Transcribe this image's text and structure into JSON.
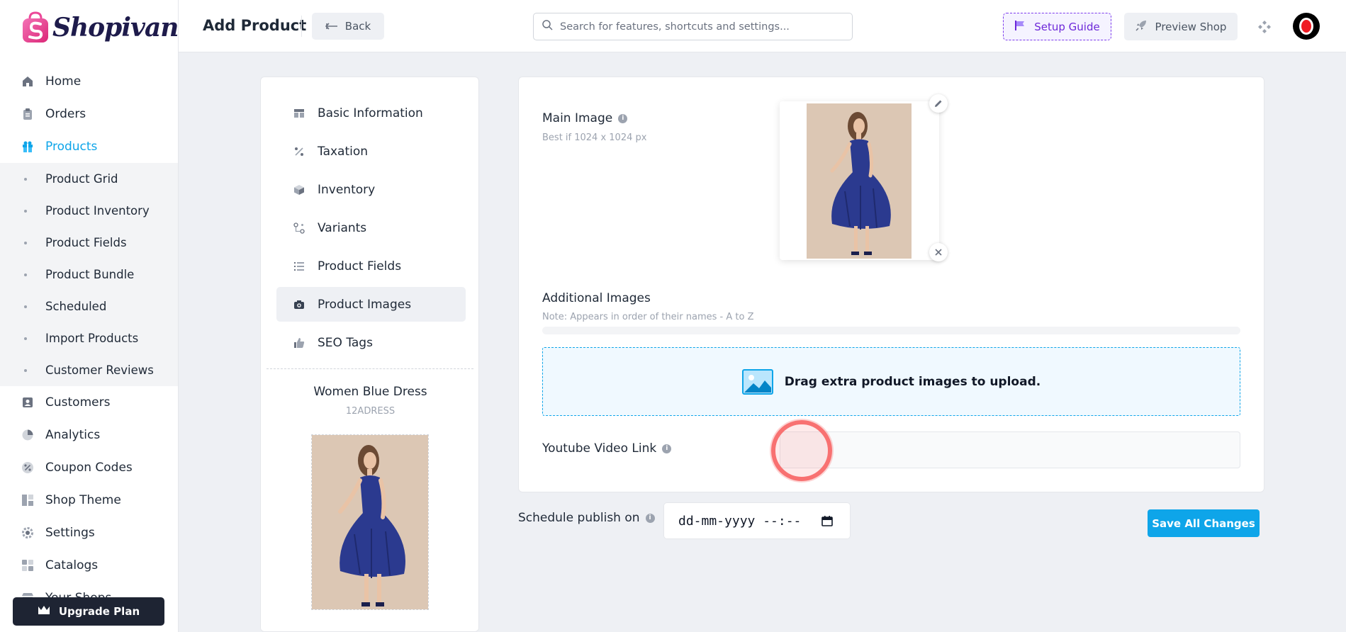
{
  "app": {
    "logo_text": "Shopivana"
  },
  "sidebar": {
    "items": [
      {
        "label": "Home",
        "icon": "home-icon"
      },
      {
        "label": "Orders",
        "icon": "clipboard-icon"
      },
      {
        "label": "Products",
        "icon": "gift-icon",
        "active": true
      }
    ],
    "sub_items": [
      {
        "label": "Product Grid"
      },
      {
        "label": "Product Inventory"
      },
      {
        "label": "Product Fields"
      },
      {
        "label": "Product Bundle"
      },
      {
        "label": "Scheduled"
      },
      {
        "label": "Import Products"
      },
      {
        "label": "Customer Reviews"
      }
    ],
    "items_after": [
      {
        "label": "Customers",
        "icon": "user-card-icon"
      },
      {
        "label": "Analytics",
        "icon": "pie-chart-icon"
      },
      {
        "label": "Coupon Codes",
        "icon": "percent-icon"
      },
      {
        "label": "Shop Theme",
        "icon": "layout-icon"
      },
      {
        "label": "Settings",
        "icon": "gear-icon"
      },
      {
        "label": "Catalogs",
        "icon": "grid-icon"
      },
      {
        "label": "Your Shops",
        "icon": "store-icon"
      }
    ],
    "upgrade_label": "Upgrade Plan"
  },
  "header": {
    "title": "Add Product",
    "back_label": "Back",
    "search_placeholder": "Search for features, shortcuts and settings...",
    "setup_label": "Setup Guide",
    "preview_label": "Preview Shop"
  },
  "tabs": [
    {
      "label": "Basic Information",
      "icon": "table-icon"
    },
    {
      "label": "Taxation",
      "icon": "percent-icon"
    },
    {
      "label": "Inventory",
      "icon": "box-icon"
    },
    {
      "label": "Variants",
      "icon": "variants-icon"
    },
    {
      "label": "Product Fields",
      "icon": "list-icon"
    },
    {
      "label": "Product Images",
      "icon": "camera-icon",
      "active": true
    },
    {
      "label": "SEO Tags",
      "icon": "thumbs-up-icon"
    }
  ],
  "product": {
    "name": "Women Blue Dress",
    "sku": "12ADRESS"
  },
  "form": {
    "main_image_label": "Main Image",
    "main_image_hint": "Best if 1024 x 1024 px",
    "additional_label": "Additional Images",
    "additional_hint": "Note: Appears in order of their names - A to Z",
    "dropzone_text": "Drag extra product images to upload.",
    "youtube_label": "Youtube Video Link",
    "youtube_value": "",
    "schedule_label": "Schedule publish on",
    "schedule_value": "dd-mm-yyyy --:--",
    "save_label": "Save All Changes"
  },
  "colors": {
    "accent": "#0ea5e9",
    "brand": "#1e1b4b",
    "setup": "#7c3aed",
    "dress": "#2b3a8f"
  }
}
